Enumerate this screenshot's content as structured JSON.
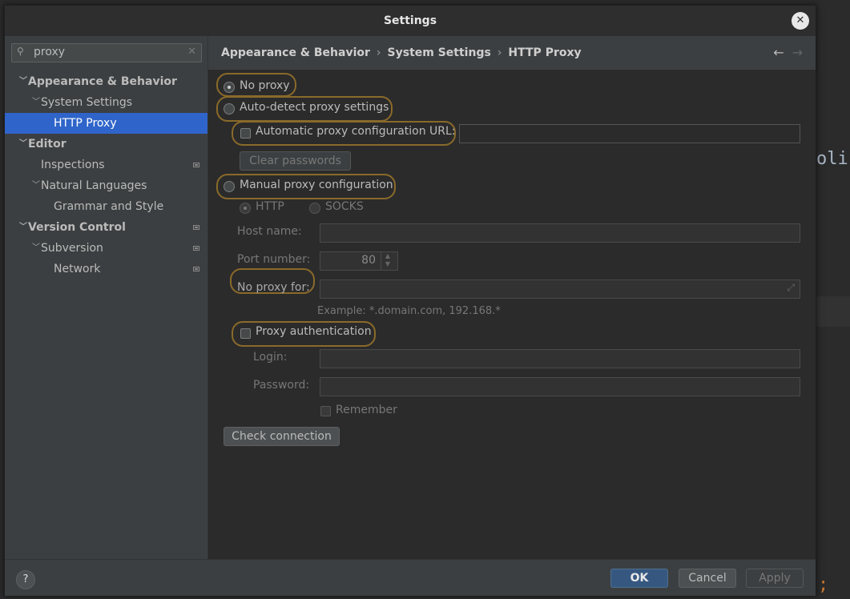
{
  "window": {
    "title": "Settings",
    "close_icon": "close-icon"
  },
  "background_editor": {
    "text_fragment": "oli",
    "semicolon": ";"
  },
  "sidebar": {
    "search": {
      "value": "proxy",
      "icon": "search-icon",
      "clear_icon": "clear-icon"
    },
    "items": [
      {
        "label": "Appearance & Behavior",
        "expanded": true,
        "bold": true
      },
      {
        "label": "System Settings",
        "expanded": true
      },
      {
        "label": "HTTP Proxy",
        "selected": true
      },
      {
        "label": "Editor",
        "expanded": true,
        "bold": true
      },
      {
        "label": "Inspections",
        "marker": true
      },
      {
        "label": "Natural Languages",
        "expanded": true
      },
      {
        "label": "Grammar and Style"
      },
      {
        "label": "Version Control",
        "expanded": true,
        "bold": true,
        "marker": true
      },
      {
        "label": "Subversion",
        "expanded": true,
        "marker": true
      },
      {
        "label": "Network",
        "marker": true
      }
    ]
  },
  "breadcrumb": {
    "parts": [
      "Appearance & Behavior",
      "System Settings",
      "HTTP Proxy"
    ],
    "separator": "›",
    "back_icon": "←",
    "forward_icon": "→"
  },
  "proxy": {
    "no_proxy": "No proxy",
    "auto_detect": "Auto-detect proxy settings",
    "auto_config_url": "Automatic proxy configuration URL:",
    "clear_passwords": "Clear passwords",
    "manual": "Manual proxy configuration",
    "http": "HTTP",
    "socks": "SOCKS",
    "host_name": "Host name:",
    "port_number": "Port number:",
    "port_value": "80",
    "no_proxy_for": "No proxy for:",
    "example": "Example: *.domain.com, 192.168.*",
    "proxy_auth": "Proxy authentication",
    "login": "Login:",
    "password": "Password:",
    "remember": "Remember",
    "check_connection": "Check connection",
    "selected_mode": "No proxy"
  },
  "footer": {
    "help": "?",
    "ok": "OK",
    "cancel": "Cancel",
    "apply": "Apply"
  },
  "colors": {
    "selection": "#2f65ca",
    "highlight_ring": "#8a6a2a",
    "primary_button": "#365880"
  }
}
